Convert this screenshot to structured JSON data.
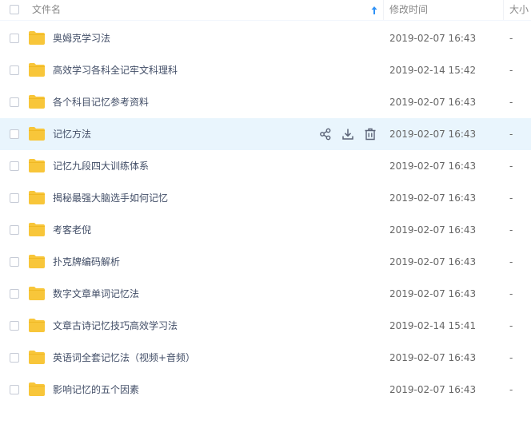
{
  "header": {
    "col_name": "文件名",
    "col_modified": "修改时间",
    "col_size": "大小",
    "sort_icon": "arrow-up-icon"
  },
  "colors": {
    "folder": "#f8c63a",
    "hover_row": "#e9f5fd",
    "sort_arrow": "#2e91f6",
    "action_icon": "#5b6377"
  },
  "row_actions": [
    "share-icon",
    "download-icon",
    "delete-icon"
  ],
  "files": [
    {
      "name": "奥姆克学习法",
      "modified": "2019-02-07 16:43",
      "size": "-"
    },
    {
      "name": "高效学习各科全记牢文科理科",
      "modified": "2019-02-14 15:42",
      "size": "-"
    },
    {
      "name": "各个科目记忆参考资料",
      "modified": "2019-02-07 16:43",
      "size": "-"
    },
    {
      "name": "记忆方法",
      "modified": "2019-02-07 16:43",
      "size": "-",
      "hover": true
    },
    {
      "name": "记忆九段四大训练体系",
      "modified": "2019-02-07 16:43",
      "size": "-"
    },
    {
      "name": "揭秘最强大脑选手如何记忆",
      "modified": "2019-02-07 16:43",
      "size": "-"
    },
    {
      "name": "考客老倪",
      "modified": "2019-02-07 16:43",
      "size": "-"
    },
    {
      "name": "扑克牌编码解析",
      "modified": "2019-02-07 16:43",
      "size": "-"
    },
    {
      "name": "数字文章单词记忆法",
      "modified": "2019-02-07 16:43",
      "size": "-"
    },
    {
      "name": "文章古诗记忆技巧高效学习法",
      "modified": "2019-02-14 15:41",
      "size": "-"
    },
    {
      "name": "英语词全套记忆法（视频+音频）",
      "modified": "2019-02-07 16:43",
      "size": "-"
    },
    {
      "name": "影响记忆的五个因素",
      "modified": "2019-02-07 16:43",
      "size": "-"
    }
  ]
}
